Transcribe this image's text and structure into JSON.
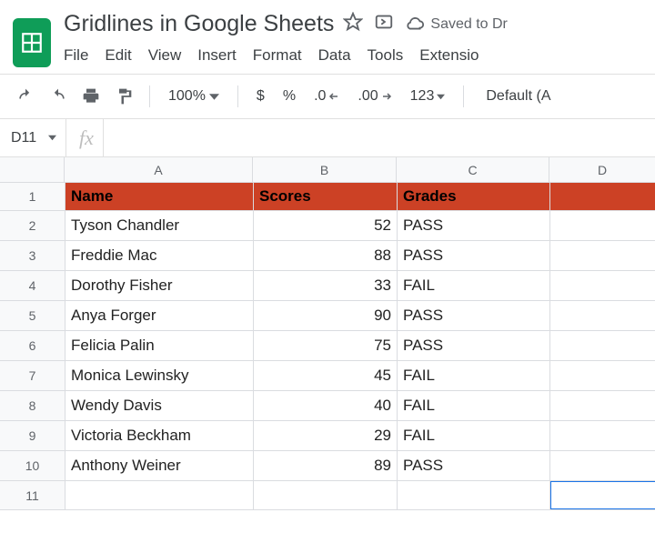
{
  "header": {
    "doc_title": "Gridlines in Google Sheets",
    "save_status": "Saved to Dr"
  },
  "menu": {
    "file": "File",
    "edit": "Edit",
    "view": "View",
    "insert": "Insert",
    "format": "Format",
    "data": "Data",
    "tools": "Tools",
    "extensions": "Extensio"
  },
  "toolbar": {
    "zoom": "100%",
    "currency": "$",
    "percent": "%",
    "dec_decrease": ".0",
    "dec_increase": ".00",
    "format_more": "123",
    "font": "Default (A"
  },
  "name_box": {
    "value": "D11"
  },
  "fx": {
    "value": ""
  },
  "columns": {
    "A": "A",
    "B": "B",
    "C": "C",
    "D": "D"
  },
  "sheet": {
    "header": {
      "name": "Name",
      "scores": "Scores",
      "grades": "Grades"
    },
    "rows": [
      {
        "n": "1"
      },
      {
        "n": "2",
        "name": "Tyson Chandler",
        "score": "52",
        "grade": "PASS"
      },
      {
        "n": "3",
        "name": "Freddie Mac",
        "score": "88",
        "grade": "PASS"
      },
      {
        "n": "4",
        "name": "Dorothy Fisher",
        "score": "33",
        "grade": " FAIL"
      },
      {
        "n": "5",
        "name": "Anya Forger",
        "score": "90",
        "grade": "PASS"
      },
      {
        "n": "6",
        "name": "Felicia Palin",
        "score": "75",
        "grade": "PASS"
      },
      {
        "n": "7",
        "name": "Monica Lewinsky",
        "score": "45",
        "grade": "FAIL"
      },
      {
        "n": "8",
        "name": "Wendy Davis",
        "score": "40",
        "grade": "FAIL"
      },
      {
        "n": "9",
        "name": "Victoria Beckham",
        "score": "29",
        "grade": "FAIL"
      },
      {
        "n": "10",
        "name": "Anthony Weiner",
        "score": "89",
        "grade": "PASS"
      },
      {
        "n": "11"
      }
    ]
  }
}
